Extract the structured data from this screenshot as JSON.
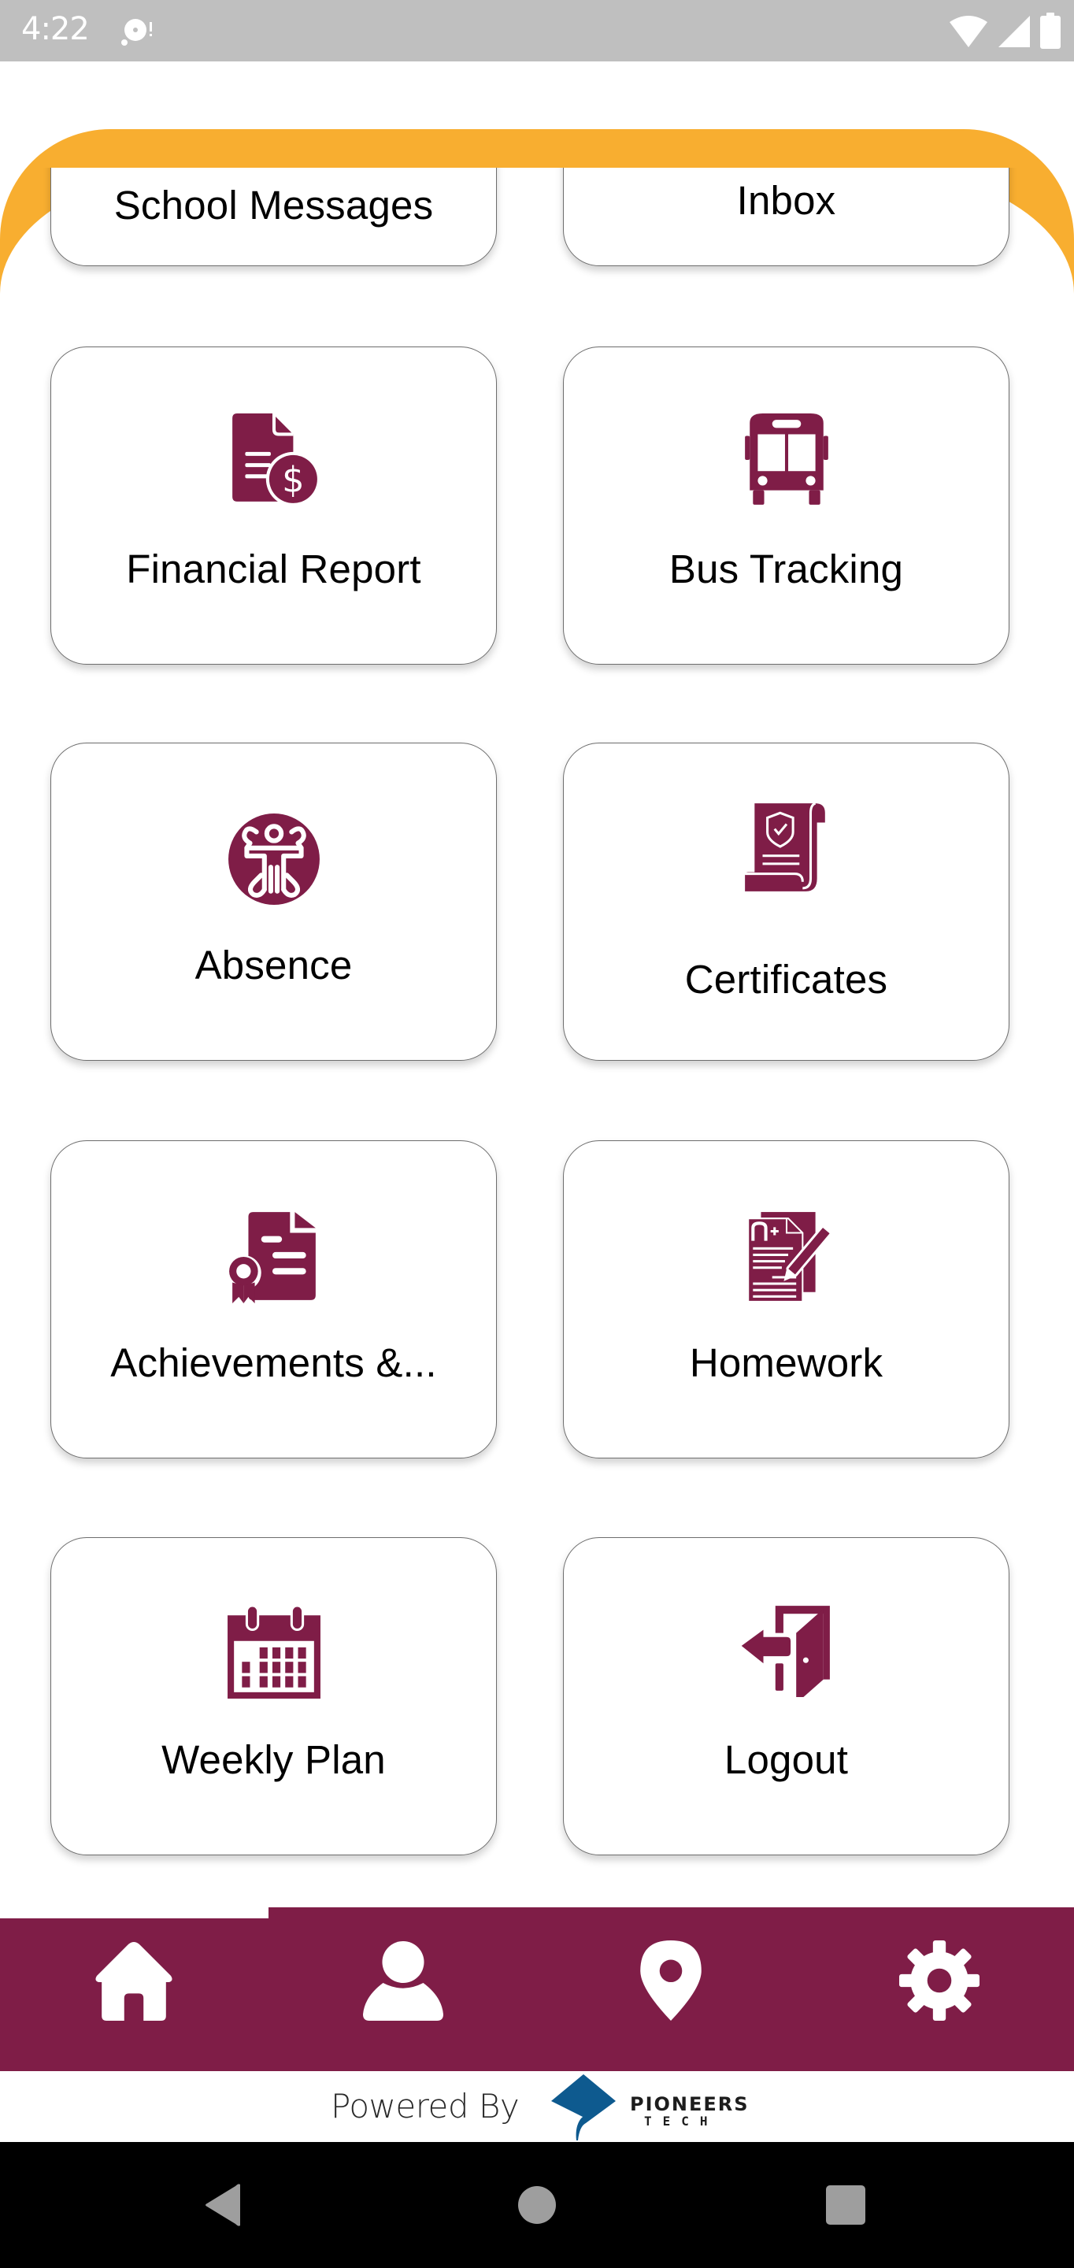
{
  "status_bar": {
    "time": "4:22",
    "notification_icon": "media-notification-icon",
    "wifi_icon": "wifi-icon",
    "signal_icon": "cellular-signal-icon",
    "battery_icon": "battery-icon"
  },
  "theme": {
    "accent_orange": "#f8ae30",
    "brand_maroon": "#7f1d47",
    "status_gray": "#bfbfbf",
    "logo_blue": "#0e5a8f"
  },
  "menu": {
    "partial_row": [
      {
        "label": "School Messages",
        "icon": "school-messages-icon"
      },
      {
        "label": "Inbox",
        "icon": "inbox-icon"
      }
    ],
    "items": [
      {
        "label": "Financial Report",
        "icon": "financial-report-icon"
      },
      {
        "label": "Bus Tracking",
        "icon": "bus-icon"
      },
      {
        "label": "Absence",
        "icon": "absence-icon"
      },
      {
        "label": "Certificates",
        "icon": "certificate-icon"
      },
      {
        "label": "Achievements &...",
        "icon": "achievement-icon"
      },
      {
        "label": "Homework",
        "icon": "homework-icon"
      },
      {
        "label": "Weekly Plan",
        "icon": "calendar-icon"
      },
      {
        "label": "Logout",
        "icon": "logout-icon"
      }
    ]
  },
  "bottom_nav": [
    {
      "name": "home",
      "icon": "home-icon"
    },
    {
      "name": "profile",
      "icon": "person-icon"
    },
    {
      "name": "location",
      "icon": "map-pin-icon"
    },
    {
      "name": "settings",
      "icon": "gear-icon"
    }
  ],
  "footer": {
    "powered_by": "Powered By",
    "company_name": "PIONEERS",
    "company_sub": "TECH"
  },
  "system_nav": {
    "back": "back-icon",
    "home": "home-circle-icon",
    "recents": "recents-icon"
  }
}
